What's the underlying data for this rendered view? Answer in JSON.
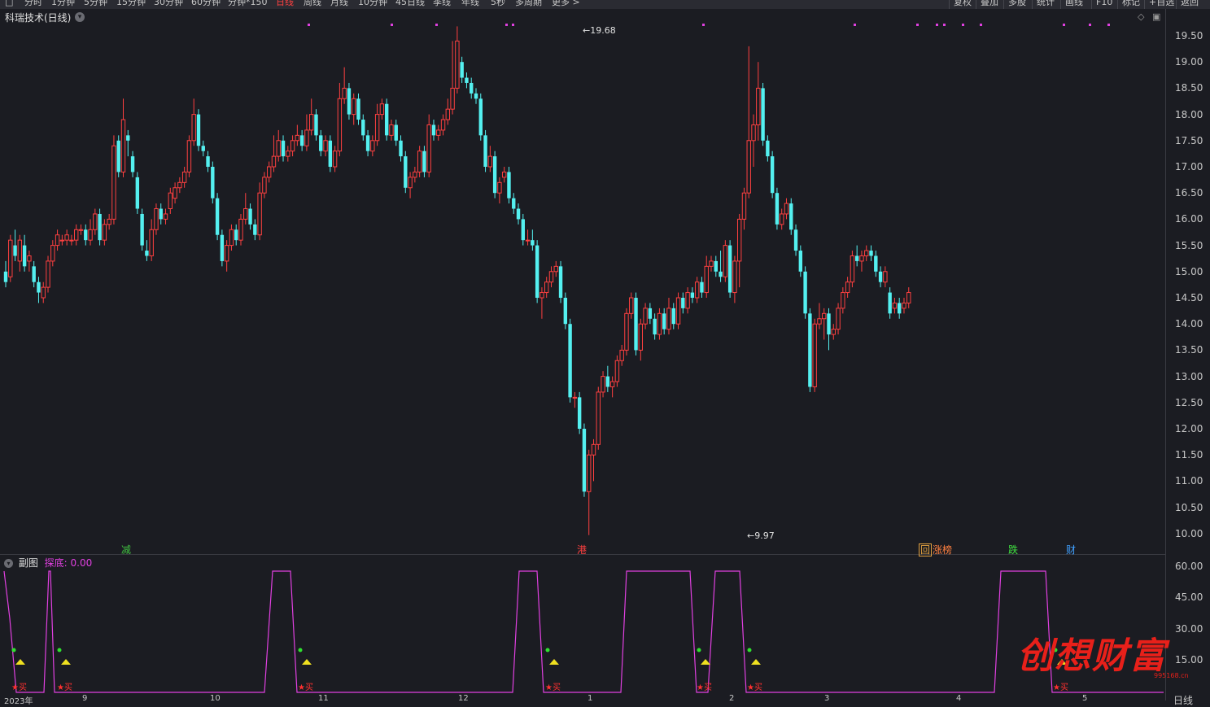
{
  "toolbar": {
    "periods": [
      {
        "label": "分时",
        "x": 30
      },
      {
        "label": "1分钟",
        "x": 63
      },
      {
        "label": "5分钟",
        "x": 103
      },
      {
        "label": "15分钟",
        "x": 143
      },
      {
        "label": "30分钟",
        "x": 189
      },
      {
        "label": "60分钟",
        "x": 235
      },
      {
        "label": "分钟*150",
        "x": 280
      },
      {
        "label": "日线",
        "x": 339,
        "active": true
      },
      {
        "label": "周线",
        "x": 373
      },
      {
        "label": "月线",
        "x": 406
      },
      {
        "label": "10分钟",
        "x": 440
      },
      {
        "label": "45日线",
        "x": 486
      },
      {
        "label": "季线",
        "x": 532
      },
      {
        "label": "年线",
        "x": 567
      },
      {
        "label": "5秒",
        "x": 603
      },
      {
        "label": "多周期",
        "x": 633
      },
      {
        "label": "更多 >",
        "x": 678
      }
    ],
    "right_buttons": [
      {
        "label": "复权",
        "x": 1172
      },
      {
        "label": "叠加",
        "x": 1205
      },
      {
        "label": "多股",
        "x": 1239
      },
      {
        "label": "统计",
        "x": 1274
      },
      {
        "label": "画线",
        "x": 1309
      },
      {
        "label": "F10",
        "x": 1347
      },
      {
        "label": "标记",
        "x": 1379
      },
      {
        "label": "+自选",
        "x": 1412
      },
      {
        "label": "返回",
        "x": 1451
      }
    ]
  },
  "title": "科瑞技术(日线)",
  "y_axis_main": [
    "19.50",
    "19.00",
    "18.50",
    "18.00",
    "17.50",
    "17.00",
    "16.50",
    "16.00",
    "15.50",
    "15.00",
    "14.50",
    "14.00",
    "13.50",
    "13.00",
    "12.50",
    "12.00",
    "11.50",
    "11.00",
    "10.50",
    "10.00"
  ],
  "y_axis_sub": [
    "60.00",
    "45.00",
    "30.00",
    "15.00"
  ],
  "annotations": {
    "high": "19.68",
    "low": "9.97"
  },
  "events": [
    {
      "label": "减",
      "color": "#40c040"
    },
    {
      "label": "港",
      "color": "#ff4040"
    },
    {
      "label": "回",
      "color": "#e0a040"
    },
    {
      "label": "涨榜",
      "color": "#ff8040"
    },
    {
      "label": "跌",
      "color": "#40e040"
    },
    {
      "label": "财",
      "color": "#40a0ff"
    }
  ],
  "sub_chart": {
    "title": "副图",
    "indicator": "探底: 0.00",
    "buy_label": "★买"
  },
  "x_labels": [
    "2023年",
    "9",
    "10",
    "11",
    "12",
    "1",
    "2",
    "3",
    "4",
    "5"
  ],
  "period_label": "日线",
  "watermark": "创想财富",
  "watermark_url": "995168.cn",
  "colors": {
    "up": "#ff4040",
    "down": "#54f0f0",
    "indicator": "#e040e0"
  },
  "chart_data": {
    "type": "candlestick",
    "ylim": [
      9.9,
      19.7
    ],
    "candles": [
      [
        15.0,
        14.8,
        15.2,
        14.7
      ],
      [
        14.9,
        15.6,
        15.7,
        14.8
      ],
      [
        15.5,
        15.3,
        15.8,
        15.2
      ],
      [
        15.2,
        15.6,
        15.7,
        15.0
      ],
      [
        15.5,
        15.1,
        15.7,
        15.0
      ],
      [
        15.2,
        15.3,
        15.4,
        15.0
      ],
      [
        15.1,
        14.8,
        15.2,
        14.7
      ],
      [
        14.8,
        14.6,
        14.9,
        14.4
      ],
      [
        14.5,
        14.7,
        14.8,
        14.4
      ],
      [
        14.7,
        15.2,
        15.3,
        14.6
      ],
      [
        15.2,
        15.5,
        15.6,
        15.1
      ],
      [
        15.5,
        15.7,
        15.8,
        15.4
      ],
      [
        15.6,
        15.6,
        15.7,
        15.5
      ],
      [
        15.6,
        15.7,
        15.8,
        15.5
      ],
      [
        15.6,
        15.6,
        15.7,
        15.5
      ],
      [
        15.6,
        15.8,
        15.9,
        15.5
      ],
      [
        15.8,
        15.8,
        15.9,
        15.7
      ],
      [
        15.8,
        15.6,
        15.9,
        15.5
      ],
      [
        15.6,
        15.8,
        16.0,
        15.5
      ],
      [
        15.8,
        16.1,
        16.2,
        15.7
      ],
      [
        16.1,
        15.6,
        16.2,
        15.5
      ],
      [
        15.6,
        15.9,
        16.0,
        15.5
      ],
      [
        15.9,
        16.0,
        16.1,
        15.8
      ],
      [
        16.0,
        17.4,
        17.6,
        15.9
      ],
      [
        17.5,
        16.9,
        17.6,
        16.8
      ],
      [
        16.9,
        17.9,
        18.3,
        16.8
      ],
      [
        17.6,
        17.5,
        17.7,
        17.2
      ],
      [
        17.2,
        16.9,
        17.3,
        16.8
      ],
      [
        16.8,
        16.2,
        16.9,
        16.1
      ],
      [
        16.1,
        15.5,
        16.2,
        15.4
      ],
      [
        15.4,
        15.3,
        15.6,
        15.2
      ],
      [
        15.3,
        15.8,
        16.0,
        15.2
      ],
      [
        15.8,
        16.2,
        16.3,
        15.7
      ],
      [
        16.2,
        16.0,
        16.3,
        15.9
      ],
      [
        16.0,
        16.1,
        16.2,
        15.9
      ],
      [
        16.2,
        16.5,
        16.6,
        16.1
      ],
      [
        16.4,
        16.6,
        16.7,
        16.3
      ],
      [
        16.6,
        16.7,
        16.8,
        16.5
      ],
      [
        16.7,
        16.9,
        17.0,
        16.6
      ],
      [
        16.9,
        17.5,
        17.6,
        16.8
      ],
      [
        17.5,
        18.0,
        18.3,
        17.4
      ],
      [
        18.0,
        17.4,
        18.1,
        17.3
      ],
      [
        17.4,
        17.3,
        17.5,
        17.2
      ],
      [
        17.2,
        17.0,
        17.3,
        16.9
      ],
      [
        17.0,
        16.4,
        17.1,
        16.3
      ],
      [
        16.4,
        15.7,
        16.5,
        15.6
      ],
      [
        15.7,
        15.2,
        15.8,
        15.1
      ],
      [
        15.2,
        15.5,
        15.6,
        15.0
      ],
      [
        15.5,
        15.8,
        15.9,
        15.4
      ],
      [
        15.8,
        15.6,
        15.9,
        15.5
      ],
      [
        15.6,
        16.0,
        16.1,
        15.5
      ],
      [
        16.0,
        16.2,
        16.5,
        15.9
      ],
      [
        16.2,
        15.9,
        16.3,
        15.8
      ],
      [
        15.9,
        15.7,
        16.0,
        15.6
      ],
      [
        15.7,
        16.5,
        16.7,
        15.6
      ],
      [
        16.5,
        16.8,
        16.9,
        16.4
      ],
      [
        16.8,
        17.0,
        17.1,
        16.7
      ],
      [
        17.0,
        17.2,
        17.6,
        16.9
      ],
      [
        17.2,
        17.5,
        17.7,
        17.1
      ],
      [
        17.5,
        17.2,
        17.6,
        17.1
      ],
      [
        17.2,
        17.3,
        17.4,
        17.1
      ],
      [
        17.3,
        17.5,
        17.6,
        17.2
      ],
      [
        17.5,
        17.6,
        17.8,
        17.4
      ],
      [
        17.6,
        17.4,
        17.7,
        17.3
      ],
      [
        17.4,
        17.7,
        18.0,
        17.3
      ],
      [
        17.7,
        18.0,
        18.3,
        17.6
      ],
      [
        18.0,
        17.6,
        18.1,
        17.5
      ],
      [
        17.6,
        17.3,
        17.7,
        17.2
      ],
      [
        17.3,
        17.5,
        17.6,
        17.2
      ],
      [
        17.5,
        17.0,
        17.6,
        16.9
      ],
      [
        17.0,
        17.3,
        17.4,
        16.9
      ],
      [
        17.3,
        18.3,
        18.6,
        17.2
      ],
      [
        18.3,
        18.5,
        18.9,
        18.2
      ],
      [
        18.5,
        18.0,
        18.6,
        17.9
      ],
      [
        18.0,
        18.3,
        18.4,
        17.8
      ],
      [
        18.3,
        17.9,
        18.4,
        17.8
      ],
      [
        17.9,
        17.6,
        18.0,
        17.5
      ],
      [
        17.6,
        17.3,
        17.7,
        17.2
      ],
      [
        17.3,
        17.5,
        17.6,
        17.2
      ],
      [
        17.5,
        18.0,
        18.2,
        17.4
      ],
      [
        18.0,
        18.2,
        18.3,
        17.9
      ],
      [
        18.2,
        17.6,
        18.3,
        17.5
      ],
      [
        17.6,
        17.8,
        17.9,
        17.5
      ],
      [
        17.8,
        17.5,
        17.9,
        17.4
      ],
      [
        17.5,
        17.2,
        17.6,
        17.1
      ],
      [
        17.2,
        16.6,
        17.3,
        16.5
      ],
      [
        16.6,
        16.8,
        16.9,
        16.4
      ],
      [
        16.8,
        16.9,
        17.0,
        16.7
      ],
      [
        16.9,
        17.3,
        17.4,
        16.8
      ],
      [
        17.3,
        16.9,
        17.4,
        16.8
      ],
      [
        16.9,
        17.8,
        18.0,
        16.8
      ],
      [
        17.8,
        17.6,
        17.9,
        17.5
      ],
      [
        17.6,
        17.7,
        17.8,
        17.5
      ],
      [
        17.7,
        17.9,
        18.0,
        17.6
      ],
      [
        17.9,
        18.1,
        18.3,
        17.8
      ],
      [
        18.1,
        18.5,
        19.4,
        18.0
      ],
      [
        18.5,
        19.4,
        19.68,
        18.4
      ],
      [
        19.0,
        18.7,
        19.1,
        18.6
      ],
      [
        18.7,
        18.6,
        18.8,
        18.5
      ],
      [
        18.6,
        18.4,
        18.7,
        18.3
      ],
      [
        18.4,
        18.3,
        18.5,
        18.2
      ],
      [
        18.3,
        17.6,
        18.4,
        17.5
      ],
      [
        17.6,
        17.0,
        17.7,
        16.9
      ],
      [
        17.0,
        17.2,
        17.4,
        16.9
      ],
      [
        17.2,
        16.5,
        17.3,
        16.4
      ],
      [
        16.5,
        16.7,
        16.8,
        16.3
      ],
      [
        16.8,
        16.9,
        17.0,
        16.7
      ],
      [
        16.9,
        16.4,
        17.0,
        16.3
      ],
      [
        16.4,
        16.2,
        16.5,
        16.1
      ],
      [
        16.2,
        16.0,
        16.3,
        15.9
      ],
      [
        16.0,
        15.6,
        16.1,
        15.5
      ],
      [
        15.6,
        15.6,
        15.8,
        15.5
      ],
      [
        15.6,
        15.5,
        15.8,
        15.4
      ],
      [
        15.5,
        14.5,
        15.6,
        14.4
      ],
      [
        14.5,
        14.6,
        14.7,
        14.1
      ],
      [
        14.6,
        14.8,
        14.9,
        14.5
      ],
      [
        14.8,
        15.0,
        15.1,
        14.7
      ],
      [
        15.0,
        15.1,
        15.2,
        14.9
      ],
      [
        15.1,
        14.5,
        15.2,
        14.4
      ],
      [
        14.5,
        14.0,
        14.6,
        13.9
      ],
      [
        14.0,
        12.6,
        14.1,
        12.5
      ],
      [
        12.6,
        12.6,
        12.7,
        12.4
      ],
      [
        12.6,
        12.0,
        12.7,
        11.9
      ],
      [
        12.0,
        10.8,
        12.1,
        10.7
      ],
      [
        10.8,
        11.5,
        11.6,
        9.97
      ],
      [
        11.5,
        11.7,
        11.8,
        11.0
      ],
      [
        11.7,
        12.7,
        12.8,
        11.6
      ],
      [
        12.7,
        13.0,
        13.1,
        12.6
      ],
      [
        13.0,
        12.8,
        13.2,
        12.7
      ],
      [
        12.8,
        12.9,
        13.0,
        12.6
      ],
      [
        12.9,
        13.3,
        13.4,
        12.8
      ],
      [
        13.3,
        13.5,
        13.6,
        13.2
      ],
      [
        13.5,
        14.2,
        14.3,
        13.4
      ],
      [
        14.2,
        14.5,
        14.6,
        14.1
      ],
      [
        14.5,
        13.5,
        14.6,
        13.4
      ],
      [
        13.5,
        14.0,
        14.1,
        13.3
      ],
      [
        14.0,
        14.3,
        14.4,
        13.9
      ],
      [
        14.3,
        14.1,
        14.4,
        14.0
      ],
      [
        14.1,
        13.8,
        14.2,
        13.7
      ],
      [
        13.8,
        14.2,
        14.3,
        13.7
      ],
      [
        14.2,
        13.9,
        14.3,
        13.8
      ],
      [
        13.9,
        14.3,
        14.5,
        13.8
      ],
      [
        14.3,
        14.0,
        14.4,
        13.9
      ],
      [
        14.0,
        14.5,
        14.6,
        13.9
      ],
      [
        14.5,
        14.3,
        14.6,
        14.2
      ],
      [
        14.3,
        14.6,
        14.7,
        14.2
      ],
      [
        14.6,
        14.5,
        14.7,
        14.4
      ],
      [
        14.5,
        14.8,
        14.9,
        14.4
      ],
      [
        14.8,
        14.6,
        14.9,
        14.5
      ],
      [
        14.6,
        15.1,
        15.3,
        14.5
      ],
      [
        15.1,
        15.2,
        15.3,
        15.0
      ],
      [
        15.2,
        15.0,
        15.3,
        14.9
      ],
      [
        15.0,
        14.9,
        15.4,
        14.8
      ],
      [
        14.9,
        15.5,
        15.6,
        14.8
      ],
      [
        15.5,
        14.6,
        15.6,
        14.5
      ],
      [
        14.6,
        15.2,
        15.3,
        14.4
      ],
      [
        15.2,
        16.0,
        16.1,
        14.7
      ],
      [
        16.0,
        16.5,
        16.6,
        15.8
      ],
      [
        16.5,
        17.5,
        19.3,
        16.4
      ],
      [
        17.5,
        17.8,
        18.0,
        17.0
      ],
      [
        17.8,
        18.5,
        19.0,
        17.5
      ],
      [
        18.5,
        17.5,
        18.6,
        17.4
      ],
      [
        17.5,
        17.2,
        17.6,
        17.1
      ],
      [
        17.2,
        16.5,
        17.3,
        16.4
      ],
      [
        16.5,
        15.9,
        16.6,
        15.8
      ],
      [
        15.9,
        16.1,
        16.2,
        15.8
      ],
      [
        16.1,
        16.3,
        16.4,
        16.0
      ],
      [
        16.3,
        15.8,
        16.4,
        15.7
      ],
      [
        15.8,
        15.4,
        15.9,
        15.3
      ],
      [
        15.4,
        15.0,
        15.5,
        14.9
      ],
      [
        15.0,
        14.2,
        15.1,
        14.1
      ],
      [
        14.2,
        12.8,
        14.3,
        12.7
      ],
      [
        12.8,
        14.0,
        14.1,
        12.7
      ],
      [
        14.0,
        14.1,
        14.4,
        13.9
      ],
      [
        14.1,
        14.2,
        14.3,
        13.7
      ],
      [
        14.2,
        13.8,
        14.3,
        13.5
      ],
      [
        13.8,
        13.9,
        14.0,
        13.7
      ],
      [
        13.9,
        14.3,
        14.4,
        13.8
      ],
      [
        14.3,
        14.6,
        14.7,
        14.2
      ],
      [
        14.6,
        14.8,
        14.9,
        14.5
      ],
      [
        14.8,
        15.3,
        15.4,
        14.7
      ],
      [
        15.3,
        15.2,
        15.5,
        15.1
      ],
      [
        15.2,
        15.3,
        15.4,
        15.0
      ],
      [
        15.3,
        15.4,
        15.5,
        15.2
      ],
      [
        15.4,
        15.3,
        15.5,
        15.2
      ],
      [
        15.3,
        15.0,
        15.4,
        14.9
      ],
      [
        15.0,
        14.8,
        15.1,
        14.7
      ],
      [
        14.8,
        15.0,
        15.1,
        14.7
      ],
      [
        14.6,
        14.2,
        14.7,
        14.1
      ],
      [
        14.3,
        14.4,
        14.5,
        14.2
      ],
      [
        14.4,
        14.2,
        14.5,
        14.1
      ],
      [
        14.3,
        14.4,
        14.5,
        14.2
      ],
      [
        14.4,
        14.6,
        14.7,
        14.3
      ]
    ],
    "signal_dots": [
      {
        "x": 17,
        "kind": "dot"
      },
      {
        "x": 73,
        "kind": "dot"
      },
      {
        "x": 369,
        "kind": "dot"
      },
      {
        "x": 673,
        "kind": "dot"
      },
      {
        "x": 859,
        "kind": "dot"
      },
      {
        "x": 921,
        "kind": "dot"
      },
      {
        "x": 1297,
        "kind": "dot"
      }
    ],
    "magenta_marks": [
      379,
      481,
      536,
      622,
      630,
      864,
      1050,
      1127,
      1151,
      1160,
      1183,
      1205,
      1307,
      1339,
      1362
    ]
  }
}
